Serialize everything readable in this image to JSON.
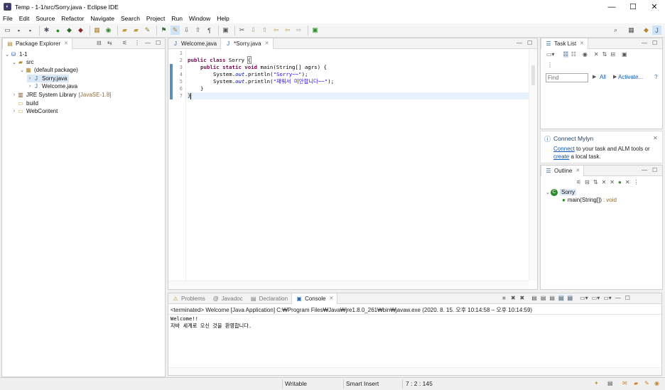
{
  "window": {
    "title": "Temp - 1-1/src/Sorry.java - Eclipse IDE",
    "minimize_glyph": "—",
    "maximize_glyph": "☐",
    "close_glyph": "✕"
  },
  "menu": [
    "File",
    "Edit",
    "Source",
    "Refactor",
    "Navigate",
    "Search",
    "Project",
    "Run",
    "Window",
    "Help"
  ],
  "package_explorer": {
    "tab_label": "Package Explorer",
    "tree": [
      {
        "label": "1-1",
        "decoration": ""
      },
      {
        "label": "src",
        "decoration": ""
      },
      {
        "label": "(default package)",
        "decoration": ""
      },
      {
        "label": "Sorry.java",
        "decoration": ""
      },
      {
        "label": "Welcome.java",
        "decoration": ""
      },
      {
        "label": "JRE System Library",
        "decoration": "[JavaSE-1.8]"
      },
      {
        "label": "build",
        "decoration": ""
      },
      {
        "label": "WebContent",
        "decoration": ""
      }
    ]
  },
  "editor": {
    "tabs": [
      {
        "label": "Welcome.java",
        "active": false
      },
      {
        "label": "*Sorry.java",
        "active": true
      }
    ],
    "line_numbers": [
      "1",
      "2",
      "3",
      "4",
      "5",
      "6",
      "7"
    ],
    "code": {
      "l2_kw": "public class",
      "l2_name": " Sorry ",
      "l2_brace": "{",
      "l3_kw": "public static void",
      "l3_rest": " main(String[] agrs) {",
      "l4_a": "System.",
      "l4_out": "out",
      "l4_b": ".println(",
      "l4_str": "\"Sorry~~\"",
      "l4_c": ");",
      "l5_a": "System.",
      "l5_out": "out",
      "l5_b": ".println(",
      "l5_str": "\"재워서 미안합니다~~\"",
      "l5_c": ");",
      "l6": "}",
      "l7": "}"
    }
  },
  "task_list": {
    "tab_label": "Task List",
    "find_placeholder": "Find",
    "all_label": "All",
    "activate_label": "Activate..."
  },
  "mylyn": {
    "title": "Connect Mylyn",
    "connect_link": "Connect",
    "text1": " to your task and ALM tools or",
    "create_link": "create",
    "text2": " a local task."
  },
  "outline": {
    "tab_label": "Outline",
    "class_name": "Sorry",
    "method_name": "main(String[])",
    "method_type": ": void"
  },
  "console": {
    "tabs": [
      "Problems",
      "Javadoc",
      "Declaration",
      "Console"
    ],
    "header": "<terminated> Welcome [Java Application] C:₩Program Files₩Java₩jre1.8.0_261₩bin₩javaw.exe  (2020. 8. 15. 오후 10:14:58 – 오후 10:14:59)",
    "lines": [
      "Welcome!!",
      "자바 세계로 오신 것을 환영합니다."
    ]
  },
  "status": {
    "writable": "Writable",
    "insert_mode": "Smart Insert",
    "position": "7 : 2 : 145"
  },
  "colors": {
    "keyword": "#7f0055",
    "string": "#2a00ff",
    "field": "#0000c0",
    "link": "#0b57c2"
  }
}
